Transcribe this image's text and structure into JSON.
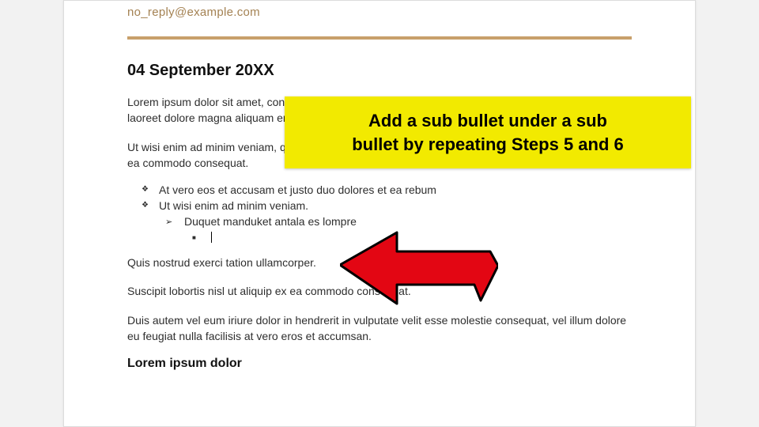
{
  "doc": {
    "email": "no_reply@example.com",
    "date_heading": "04 September 20XX",
    "para1": "Lorem ipsum dolor sit amet, consectetuer adipiscing elit, sed diam nonummy nibh euismod tincidunt ut laoreet dolore magna aliquam erat volutpat.",
    "para2": "Ut wisi enim ad minim veniam, quis nostrud exerci tation ullamcorper suscipit lobortis nisl ut aliquip ex ea commodo consequat.",
    "bullets": {
      "l1a": "At vero eos et accusam et justo duo dolores et ea rebum",
      "l1b": "Ut wisi enim ad minim veniam.",
      "l2a": "Duquet manduket antala es lompre",
      "l3a": ""
    },
    "para3": "Quis nostrud exerci tation ullamcorper.",
    "para4": "Suscipit lobortis nisl ut aliquip ex ea commodo consequat.",
    "para5": "Duis autem vel eum iriure dolor in hendrerit in vulputate velit esse molestie consequat, vel illum dolore eu feugiat nulla facilisis at vero eros et accumsan.",
    "section2": "Lorem ipsum dolor"
  },
  "callout": {
    "line1": "Add a sub bullet under a sub",
    "line2": "bullet by repeating Steps 5 and 6"
  },
  "colors": {
    "gold": "#c8a06b",
    "callout_bg": "#f2ea00",
    "arrow": "#e30613"
  }
}
